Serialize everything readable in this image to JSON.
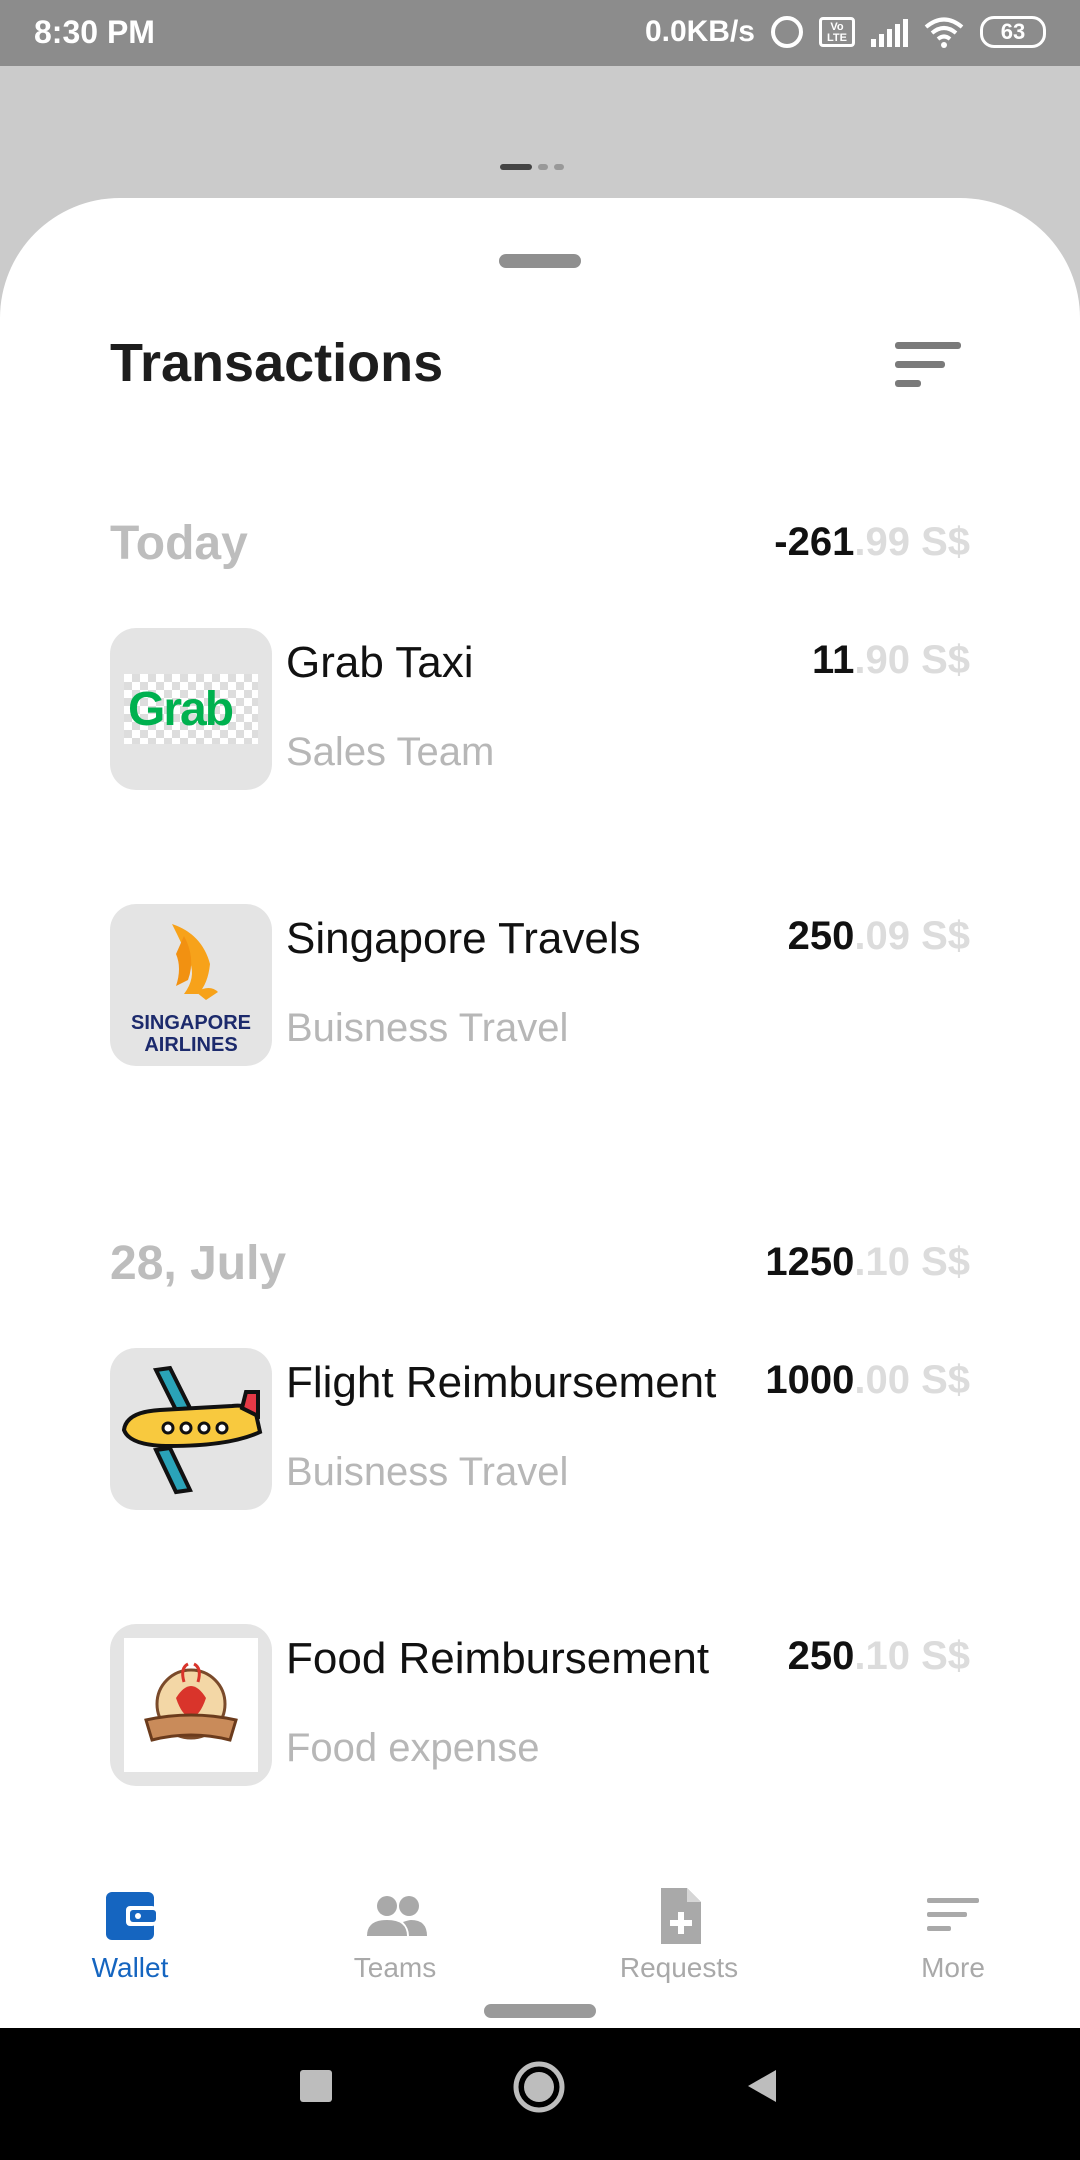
{
  "status_bar": {
    "time": "8:30 PM",
    "network_speed": "0.0KB/s",
    "volte_label": "Vo LTE",
    "battery": "63",
    "icons": [
      "alarm-icon",
      "volte-icon",
      "signal-icon",
      "wifi-icon",
      "battery-icon"
    ]
  },
  "sheet": {
    "title": "Transactions",
    "filter_icon": "sort-filter-icon"
  },
  "sections": [
    {
      "label": "Today",
      "amount_int": "-261",
      "amount_dec": ".99 S$",
      "items": [
        {
          "title": "Grab Taxi",
          "category": "Sales Team",
          "amount_int": "11",
          "amount_dec": ".90 S$",
          "logo_text": "Grab",
          "logo_color": "#00b14f"
        },
        {
          "title": "Singapore Travels",
          "category": "Buisness Travel",
          "amount_int": "250",
          "amount_dec": ".09 S$",
          "logo_text_1": "SINGAPORE",
          "logo_text_2": "AIRLINES",
          "logo_color": "#f7a21a"
        }
      ]
    },
    {
      "label": "28, July",
      "amount_int": "1250",
      "amount_dec": ".10 S$",
      "items": [
        {
          "title": "Flight Reimbursement",
          "category": "Buisness Travel",
          "amount_int": "1000",
          "amount_dec": ".00 S$",
          "logo_icon": "airplane-icon"
        },
        {
          "title": "Food Reimbursement",
          "category": "Food expense",
          "amount_int": "250",
          "amount_dec": ".10 S$",
          "logo_icon": "food-logo-icon"
        }
      ]
    }
  ],
  "bottom_nav": {
    "items": [
      {
        "label": "Wallet",
        "icon": "wallet-icon",
        "active": true
      },
      {
        "label": "Teams",
        "icon": "people-icon",
        "active": false
      },
      {
        "label": "Requests",
        "icon": "document-add-icon",
        "active": false
      },
      {
        "label": "More",
        "icon": "menu-lines-icon",
        "active": false
      }
    ]
  },
  "colors": {
    "accent": "#1565c0",
    "muted_text": "#b7b7b7",
    "decimal_text": "#dcdcdc"
  }
}
